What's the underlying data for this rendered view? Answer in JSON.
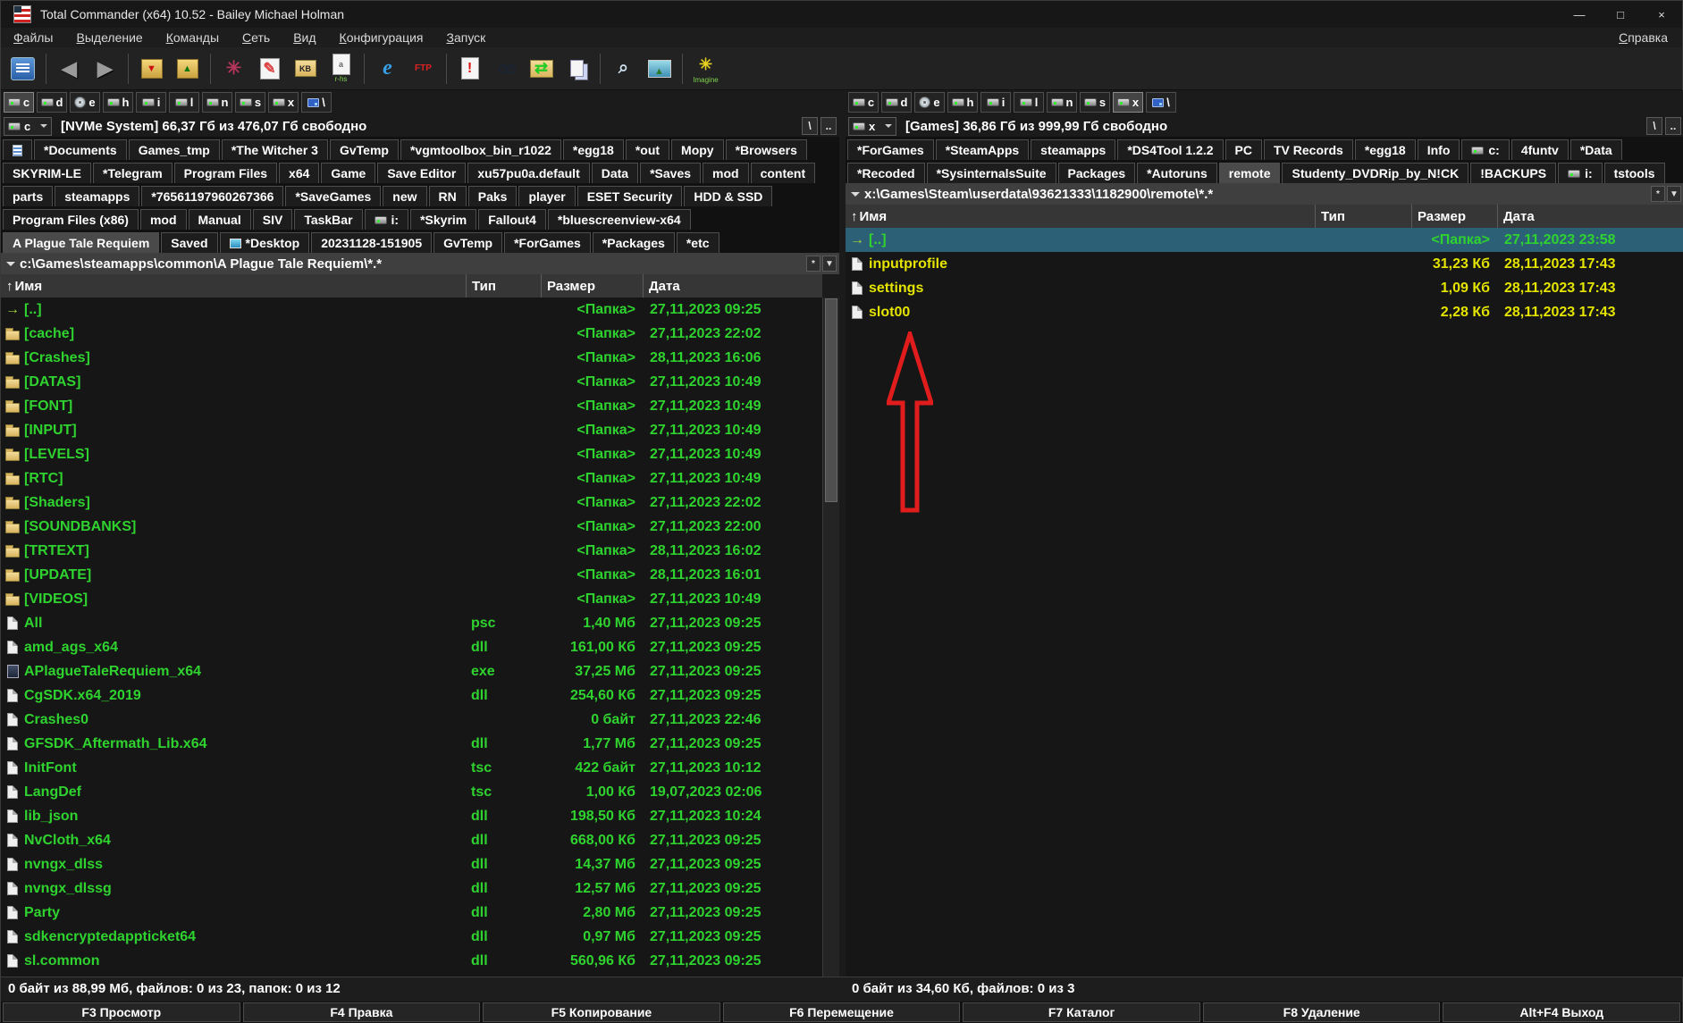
{
  "window": {
    "title": "Total Commander (x64) 10.52 - Bailey Michael Holman",
    "controls": {
      "minimize": "—",
      "maximize": "□",
      "close": "×"
    }
  },
  "menu": {
    "items": [
      "Файлы",
      "Выделение",
      "Команды",
      "Сеть",
      "Вид",
      "Конфигурация",
      "Запуск"
    ],
    "help": "Справка"
  },
  "toolbar": {
    "buttons": [
      {
        "name": "options-button",
        "icon": "panel"
      },
      {
        "separator": true
      },
      {
        "name": "back-button",
        "icon": "arrow-left",
        "glyph": "◀"
      },
      {
        "name": "forward-button",
        "icon": "arrow-right",
        "glyph": "▶"
      },
      {
        "separator": true
      },
      {
        "name": "pack-button",
        "icon": "pack",
        "glyph": "▼"
      },
      {
        "name": "unpack-button",
        "icon": "unpack",
        "glyph": "▲"
      },
      {
        "separator": true
      },
      {
        "name": "test-archive-button",
        "icon": "asterisk",
        "glyph": "✳"
      },
      {
        "name": "edit-file-button",
        "icon": "pencil",
        "glyph": "✎"
      },
      {
        "name": "calc-space-button",
        "icon": "folder-kb",
        "glyph": "KB"
      },
      {
        "name": "attributes-button",
        "icon": "attributes",
        "glyph": "a",
        "caption": "r-hs"
      },
      {
        "separator": true
      },
      {
        "name": "explorer-button",
        "icon": "ie",
        "glyph": "e"
      },
      {
        "name": "ftp-button",
        "icon": "ftp",
        "glyph": "FTP"
      },
      {
        "separator": true
      },
      {
        "name": "important-doc-button",
        "icon": "doc-exclaim",
        "glyph": "!"
      },
      {
        "name": "search-button",
        "icon": "binoculars",
        "glyph": "⊙⊙"
      },
      {
        "name": "sync-dirs-button",
        "icon": "sync",
        "glyph": "⇄"
      },
      {
        "name": "copy-clipboard-button",
        "icon": "copy-pages"
      },
      {
        "separator": true
      },
      {
        "name": "lister-button",
        "icon": "magnifier",
        "glyph": "⌕"
      },
      {
        "name": "image-viewer-button",
        "icon": "picture",
        "glyph": "▲"
      },
      {
        "separator": true
      },
      {
        "name": "imagine-button",
        "icon": "flower",
        "glyph": "✳",
        "caption": "Imagine"
      }
    ]
  },
  "path_bar_buttons": {
    "star": "*",
    "history": "▼"
  },
  "left_panel": {
    "drive_bar": [
      {
        "letter": "c",
        "kind": "hdd",
        "selected": true
      },
      {
        "letter": "d",
        "kind": "hdd"
      },
      {
        "letter": "e",
        "kind": "cd"
      },
      {
        "letter": "h",
        "kind": "hdd"
      },
      {
        "letter": "i",
        "kind": "hdd"
      },
      {
        "letter": "l",
        "kind": "hdd"
      },
      {
        "letter": "n",
        "kind": "hdd"
      },
      {
        "letter": "s",
        "kind": "hdd"
      },
      {
        "letter": "x",
        "kind": "hdd"
      },
      {
        "letter": "\\",
        "kind": "net"
      }
    ],
    "drive_info": {
      "drive": "c",
      "free_space": "[NVMe System]  66,37 Гб из 476,07 Гб свободно",
      "root_button": "\\",
      "parent_button": ".."
    },
    "tab_rows": [
      [
        {
          "icon": "list",
          "label": ""
        },
        {
          "label": "*Documents"
        },
        {
          "label": "Games_tmp"
        },
        {
          "label": "*The Witcher 3"
        },
        {
          "label": "GvTemp"
        },
        {
          "label": "*vgmtoolbox_bin_r1022"
        },
        {
          "label": "*egg18"
        },
        {
          "label": "*out"
        },
        {
          "label": "Mopy"
        },
        {
          "label": "*Browsers"
        }
      ],
      [
        {
          "label": "SKYRIM-LE"
        },
        {
          "label": "*Telegram"
        },
        {
          "label": "Program Files"
        },
        {
          "label": "x64"
        },
        {
          "label": "Game"
        },
        {
          "label": "Save Editor"
        },
        {
          "label": "xu57pu0a.default"
        },
        {
          "label": "Data"
        },
        {
          "label": "*Saves"
        },
        {
          "label": "mod"
        },
        {
          "label": "content"
        }
      ],
      [
        {
          "label": "parts"
        },
        {
          "label": "steamapps"
        },
        {
          "label": "*76561197960267366"
        },
        {
          "label": "*SaveGames"
        },
        {
          "label": "new"
        },
        {
          "label": "RN"
        },
        {
          "label": "Paks"
        },
        {
          "label": "player"
        },
        {
          "label": "ESET Security"
        },
        {
          "label": "HDD & SSD"
        }
      ],
      [
        {
          "label": "Program Files (x86)"
        },
        {
          "label": "mod"
        },
        {
          "label": "Manual"
        },
        {
          "label": "SIV"
        },
        {
          "label": "TaskBar"
        },
        {
          "icon": "drive",
          "label": "i:"
        },
        {
          "label": "*Skyrim"
        },
        {
          "label": "Fallout4"
        },
        {
          "label": "*bluescreenview-x64"
        }
      ],
      [
        {
          "label": "A Plague Tale Requiem",
          "active": true
        },
        {
          "label": "Saved"
        },
        {
          "icon": "desktop",
          "label": "*Desktop"
        },
        {
          "label": "20231128-151905"
        },
        {
          "label": "GvTemp"
        },
        {
          "label": "*ForGames"
        },
        {
          "label": "*Packages"
        },
        {
          "label": "*etc"
        }
      ]
    ],
    "path": "c:\\Games\\steamapps\\common\\A Plague Tale Requiem\\*.*",
    "sort_indicator": "↑",
    "columns": [
      "Имя",
      "Тип",
      "Размер",
      "Дата"
    ],
    "files": [
      {
        "name": "[..]",
        "kind": "up",
        "type": "",
        "size": "<Папка>",
        "date": "27,11,2023 09:25"
      },
      {
        "name": "[cache]",
        "kind": "folder",
        "type": "",
        "size": "<Папка>",
        "date": "27,11,2023 22:02"
      },
      {
        "name": "[Crashes]",
        "kind": "folder",
        "type": "",
        "size": "<Папка>",
        "date": "28,11,2023 16:06"
      },
      {
        "name": "[DATAS]",
        "kind": "folder",
        "type": "",
        "size": "<Папка>",
        "date": "27,11,2023 10:49"
      },
      {
        "name": "[FONT]",
        "kind": "folder",
        "type": "",
        "size": "<Папка>",
        "date": "27,11,2023 10:49"
      },
      {
        "name": "[INPUT]",
        "kind": "folder",
        "type": "",
        "size": "<Папка>",
        "date": "27,11,2023 10:49"
      },
      {
        "name": "[LEVELS]",
        "kind": "folder",
        "type": "",
        "size": "<Папка>",
        "date": "27,11,2023 10:49"
      },
      {
        "name": "[RTC]",
        "kind": "folder",
        "type": "",
        "size": "<Папка>",
        "date": "27,11,2023 10:49"
      },
      {
        "name": "[Shaders]",
        "kind": "folder",
        "type": "",
        "size": "<Папка>",
        "date": "27,11,2023 22:02"
      },
      {
        "name": "[SOUNDBANKS]",
        "kind": "folder",
        "type": "",
        "size": "<Папка>",
        "date": "27,11,2023 22:00"
      },
      {
        "name": "[TRTEXT]",
        "kind": "folder",
        "type": "",
        "size": "<Папка>",
        "date": "28,11,2023 16:02"
      },
      {
        "name": "[UPDATE]",
        "kind": "folder",
        "type": "",
        "size": "<Папка>",
        "date": "28,11,2023 16:01"
      },
      {
        "name": "[VIDEOS]",
        "kind": "folder",
        "type": "",
        "size": "<Папка>",
        "date": "27,11,2023 10:49"
      },
      {
        "name": "All",
        "kind": "file",
        "type": "psc",
        "size": "1,40 Мб",
        "date": "27,11,2023 09:25"
      },
      {
        "name": "amd_ags_x64",
        "kind": "file",
        "type": "dll",
        "size": "161,00 Кб",
        "date": "27,11,2023 09:25"
      },
      {
        "name": "APlagueTaleRequiem_x64",
        "kind": "exe",
        "type": "exe",
        "size": "37,25 Мб",
        "date": "27,11,2023 09:25"
      },
      {
        "name": "CgSDK.x64_2019",
        "kind": "file",
        "type": "dll",
        "size": "254,60 Кб",
        "date": "27,11,2023 09:25"
      },
      {
        "name": "Crashes0",
        "kind": "file",
        "type": "",
        "size": "0 байт",
        "date": "27,11,2023 22:46"
      },
      {
        "name": "GFSDK_Aftermath_Lib.x64",
        "kind": "file",
        "type": "dll",
        "size": "1,77 Мб",
        "date": "27,11,2023 09:25"
      },
      {
        "name": "InitFont",
        "kind": "file",
        "type": "tsc",
        "size": "422 байт",
        "date": "27,11,2023 10:12"
      },
      {
        "name": "LangDef",
        "kind": "file",
        "type": "tsc",
        "size": "1,00 Кб",
        "date": "19,07,2023 02:06"
      },
      {
        "name": "lib_json",
        "kind": "file",
        "type": "dll",
        "size": "198,50 Кб",
        "date": "27,11,2023 10:24"
      },
      {
        "name": "NvCloth_x64",
        "kind": "file",
        "type": "dll",
        "size": "668,00 Кб",
        "date": "27,11,2023 09:25"
      },
      {
        "name": "nvngx_dlss",
        "kind": "file",
        "type": "dll",
        "size": "14,37 Мб",
        "date": "27,11,2023 09:25"
      },
      {
        "name": "nvngx_dlssg",
        "kind": "file",
        "type": "dll",
        "size": "12,57 Мб",
        "date": "27,11,2023 09:25"
      },
      {
        "name": "Party",
        "kind": "file",
        "type": "dll",
        "size": "2,80 Мб",
        "date": "27,11,2023 09:25"
      },
      {
        "name": "sdkencryptedappticket64",
        "kind": "file",
        "type": "dll",
        "size": "0,97 Мб",
        "date": "27,11,2023 09:25"
      },
      {
        "name": "sl.common",
        "kind": "file",
        "type": "dll",
        "size": "560,96 Кб",
        "date": "27,11,2023 09:25"
      }
    ],
    "status": "0 байт из 88,99 Мб, файлов: 0 из 23, папок: 0 из 12"
  },
  "right_panel": {
    "drive_bar": [
      {
        "letter": "c",
        "kind": "hdd"
      },
      {
        "letter": "d",
        "kind": "hdd"
      },
      {
        "letter": "e",
        "kind": "cd"
      },
      {
        "letter": "h",
        "kind": "hdd"
      },
      {
        "letter": "i",
        "kind": "hdd"
      },
      {
        "letter": "l",
        "kind": "hdd"
      },
      {
        "letter": "n",
        "kind": "hdd"
      },
      {
        "letter": "s",
        "kind": "hdd"
      },
      {
        "letter": "x",
        "kind": "hdd",
        "selected": true
      },
      {
        "letter": "\\",
        "kind": "net"
      }
    ],
    "drive_info": {
      "drive": "x",
      "free_space": "[Games]  36,86 Гб из 999,99 Гб свободно",
      "root_button": "\\",
      "parent_button": ".."
    },
    "tab_rows": [
      [
        {
          "label": "*ForGames"
        },
        {
          "label": "*SteamApps"
        },
        {
          "label": "steamapps"
        },
        {
          "label": "*DS4Tool 1.2.2"
        },
        {
          "label": "PC"
        },
        {
          "label": "TV Records"
        },
        {
          "label": "*egg18"
        },
        {
          "label": "Info"
        },
        {
          "icon": "drive",
          "label": "c:"
        },
        {
          "label": "4funtv"
        },
        {
          "label": "*Data"
        }
      ],
      [
        {
          "label": "*Recoded"
        },
        {
          "label": "*SysinternalsSuite"
        },
        {
          "label": "Packages"
        },
        {
          "label": "*Autoruns"
        },
        {
          "label": "remote",
          "active": true
        },
        {
          "label": "Studenty_DVDRip_by_N!CK"
        },
        {
          "label": "!BACKUPS"
        },
        {
          "icon": "drive",
          "label": "i:"
        },
        {
          "label": "tstools"
        }
      ]
    ],
    "path": "x:\\Games\\Steam\\userdata\\93621333\\1182900\\remote\\*.*",
    "sort_indicator": "↑",
    "columns": [
      "Имя",
      "Тип",
      "Размер",
      "Дата"
    ],
    "files": [
      {
        "name": "[..]",
        "kind": "up",
        "type": "",
        "size": "<Папка>",
        "date": "27,11,2023 23:58",
        "selected": true
      },
      {
        "name": "inputprofile",
        "kind": "file",
        "type": "",
        "size": "31,23 Кб",
        "date": "28,11,2023 17:43"
      },
      {
        "name": "settings",
        "kind": "file",
        "type": "",
        "size": "1,09 Кб",
        "date": "28,11,2023 17:43"
      },
      {
        "name": "slot00",
        "kind": "file",
        "type": "",
        "size": "2,28 Кб",
        "date": "28,11,2023 17:43"
      }
    ],
    "status": "0 байт из 34,60 Кб, файлов: 0 из 3"
  },
  "function_bar": {
    "buttons": [
      "F3 Просмотр",
      "F4 Правка",
      "F5 Копирование",
      "F6 Перемещение",
      "F7 Каталог",
      "F8 Удаление",
      "Alt+F4 Выход"
    ]
  },
  "annotations": {
    "red_arrow": {
      "color": "#e11c1c",
      "points_to": "slot00"
    }
  },
  "colors": {
    "list_text_green": "#2fd32f",
    "list_text_yellow": "#e4e400",
    "selection_bg": "#2c6077",
    "annotation_red": "#e11c1c"
  }
}
